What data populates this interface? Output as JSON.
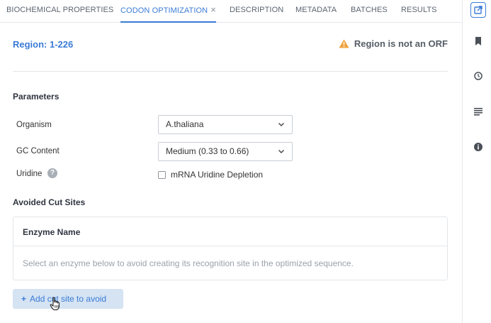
{
  "tabs": [
    {
      "label": "BIOCHEMICAL PROPERTIES",
      "active": false
    },
    {
      "label": "CODON OPTIMIZATION",
      "active": true,
      "closable": true
    },
    {
      "label": "DESCRIPTION",
      "active": false
    },
    {
      "label": "METADATA",
      "active": false
    },
    {
      "label": "BATCHES",
      "active": false
    },
    {
      "label": "RESULTS",
      "active": false
    }
  ],
  "tab_close_glyph": "×",
  "region": {
    "label": "Region: 1-226"
  },
  "warning": {
    "text": "Region is not an ORF",
    "icon": "warning-triangle-icon",
    "color": "#f0a23b"
  },
  "parameters": {
    "title": "Parameters",
    "organism": {
      "label": "Organism",
      "value": "A.thaliana"
    },
    "gc_content": {
      "label": "GC Content",
      "value": "Medium (0.33 to 0.66)"
    },
    "uridine": {
      "label": "Uridine",
      "help_glyph": "?",
      "checkbox_label": "mRNA Uridine Depletion",
      "checked": false
    }
  },
  "avoided_cut_sites": {
    "title": "Avoided Cut Sites",
    "column_header": "Enzyme Name",
    "empty_message": "Select an enzyme below to avoid creating its recognition site in the optimized sequence.",
    "add_button": {
      "plus": "+",
      "label": "Add cut site to avoid"
    }
  },
  "rail_icons": [
    "share-icon",
    "bookmark-icon",
    "clock-icon",
    "list-icon",
    "info-icon"
  ],
  "colors": {
    "accent": "#3a7bd5",
    "warning": "#f0a23b",
    "button_bg": "#d5e3f3"
  }
}
